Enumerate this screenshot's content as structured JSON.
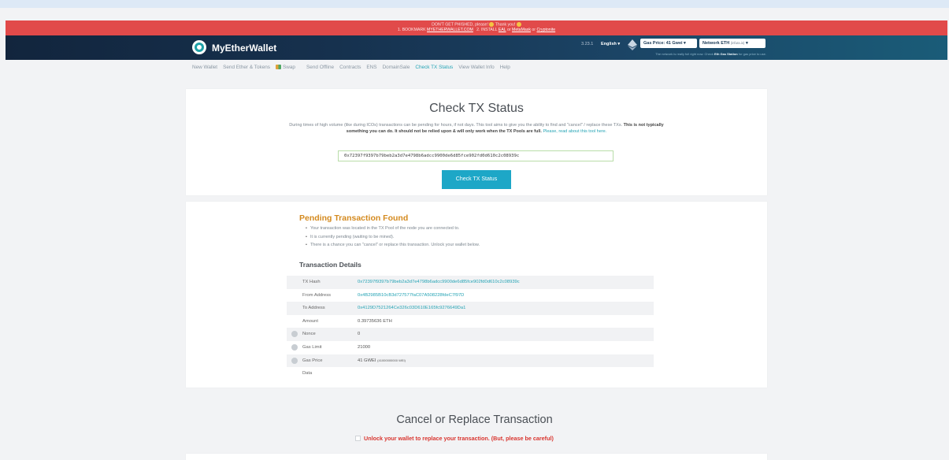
{
  "banner": {
    "line1_text": "DON'T GET PHISHED, please!",
    "line1_thanks": "Thank you!",
    "line2_prefix": "1. BOOKMARK",
    "line2_link1": "MYETHERWALLET.COM",
    "line2_middle": "2. INSTALL",
    "line2_link2": "EAL",
    "line2_or1": "or",
    "line2_link3": "MetaMask",
    "line2_or2": "or",
    "line2_link4": "Cryptonite"
  },
  "header": {
    "brand": "MyEtherWallet",
    "version": "3.23.1",
    "language": "English",
    "gas_price": "Gas Price: 41 Gwei",
    "network": "Network ETH",
    "network_sub": "(infura.io)",
    "gas_note_prefix": "The network is really full right now. Check",
    "gas_note_link": "Eth Gas Station",
    "gas_note_suffix": "for gas price to use."
  },
  "nav": {
    "items": [
      "New Wallet",
      "Send Ether & Tokens",
      "Swap",
      "Send Offline",
      "Contracts",
      "ENS",
      "DomainSale",
      "Check TX Status",
      "View Wallet Info",
      "Help"
    ],
    "active": "Check TX Status"
  },
  "check": {
    "title": "Check TX Status",
    "desc_plain": "During times of high volume (like during ICOs) transactions can be pending for hours, if not days. This tool aims to give you the ability to find and \"cancel\" / replace these TXs.",
    "desc_bold": "This is not typically something you can do. It should not be relied upon & will only work when the TX Pools are full.",
    "desc_link": "Please, read about this tool here.",
    "tx_input": "0x72397f9397b79beb2a3d7e4798b6adcc9900de6d85fce902fd0d610c2c08939c",
    "button": "Check TX Status"
  },
  "pending": {
    "title": "Pending Transaction Found",
    "bullets": [
      "Your transaction was located in the TX Pool of the node you are connected to.",
      "It is currently pending (waiting to be mined).",
      "There is a chance you can \"cancel\" or replace this transaction. Unlock your wallet below."
    ],
    "details_title": "Transaction Details",
    "rows": {
      "tx_hash": {
        "label": "TX Hash",
        "value": "0x72397f9397b79beb2a3d7e4798b6adcc9900de6d85fce902fd0d610c2c08939c"
      },
      "from": {
        "label": "From Address",
        "value": "0x4B2985B10cB3d727577faC07A508228fdeC7f97D"
      },
      "to": {
        "label": "To Address",
        "value": "0x4129D7521264Ce326c03D610E165fc9276649Da1"
      },
      "amount": {
        "label": "Amount",
        "value": "0.39735636 ETH"
      },
      "nonce": {
        "label": "Nonce",
        "value": "0"
      },
      "gas_limit": {
        "label": "Gas Limit",
        "value": "21000"
      },
      "gas_price": {
        "label": "Gas Price",
        "value": "41 GWEI",
        "wei": "(41000000000 WEI)"
      },
      "data": {
        "label": "Data",
        "value": ""
      }
    }
  },
  "cancel": {
    "title": "Cancel or Replace Transaction",
    "unlock_text": "Unlock your wallet to replace your transaction. (But, please be careful)"
  }
}
